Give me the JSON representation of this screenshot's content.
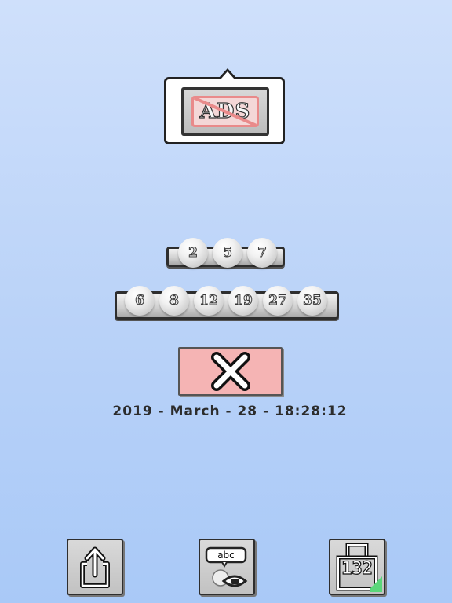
{
  "remove_ads": {
    "label": "ADS",
    "icon": "no-ads-icon"
  },
  "draw_rows": [
    {
      "numbers": [
        "2",
        "5",
        "7"
      ]
    },
    {
      "numbers": [
        "6",
        "8",
        "12",
        "19",
        "27",
        "35"
      ]
    }
  ],
  "close_button": {
    "icon": "close-icon",
    "color": "#f5b4b4"
  },
  "timestamp": "2019 - March - 28 - 18:28:12",
  "toolbar": {
    "share": {
      "icon": "share-icon"
    },
    "text_mode": {
      "label": "abc",
      "icon": "text-eye-icon"
    },
    "number_mode": {
      "label": "132",
      "icon": "number-bucket-icon"
    }
  },
  "colors": {
    "background": "#b9d2f8",
    "accent_red": "#e98a8a",
    "accent_green": "#5ad67a"
  }
}
